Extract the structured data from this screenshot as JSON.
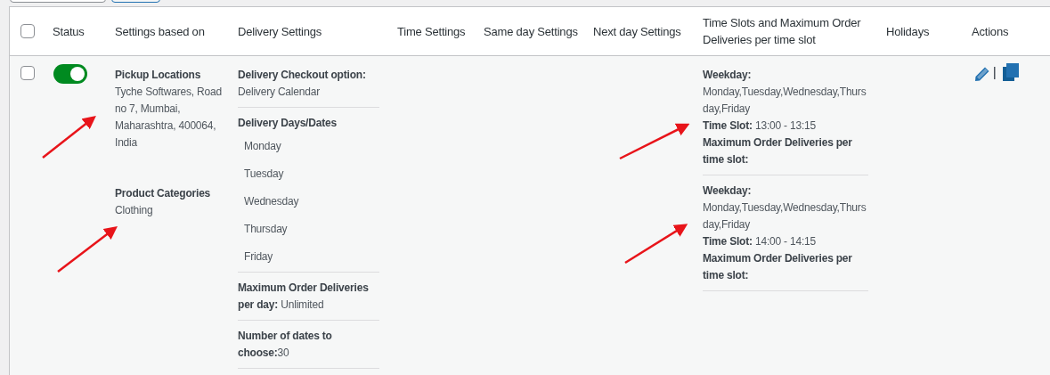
{
  "table": {
    "select_all": {
      "checked": false
    },
    "columns": [
      "Status",
      "Settings based on",
      "Delivery Settings",
      "Time Settings",
      "Same day Settings",
      "Next day Settings",
      "Time Slots and Maximum Order Deliveries per time slot",
      "Holidays",
      "Actions"
    ],
    "rows": [
      {
        "checked": false,
        "enabled": true,
        "settings_based_on": [
          {
            "label": "Pickup Locations",
            "value": "Tyche Softwares, Road no 7, Mumbai, Maharashtra, 400064, India"
          },
          {
            "label": "Product Categories",
            "value": "Clothing"
          }
        ],
        "delivery_settings": [
          {
            "kind": "field",
            "label": "Delivery Checkout option:",
            "value": "Delivery Calendar"
          },
          {
            "kind": "list",
            "label": "Delivery Days/Dates",
            "items": [
              "Monday",
              "Tuesday",
              "Wednesday",
              "Thursday",
              "Friday"
            ]
          },
          {
            "kind": "inline",
            "text": "**Maximum Order Deliveries per day:** Unlimited"
          },
          {
            "kind": "inline",
            "text": "**Number of dates to choose:**30"
          }
        ],
        "time_slots": [
          {
            "weekday_label": "Weekday:",
            "weekdays": "Monday,Tuesday,Wednesday,Thursday,Friday",
            "slot": "**Time Slot:** 13:00 - 13:15",
            "max_label": "Maximum Order Deliveries per time slot:"
          },
          {
            "weekday_label": "Weekday:",
            "weekdays": "Monday,Tuesday,Wednesday,Thursday,Friday",
            "slot": "**Time Slot:** 14:00 - 14:15",
            "max_label": "Maximum Order Deliveries per time slot:"
          }
        ]
      }
    ]
  }
}
